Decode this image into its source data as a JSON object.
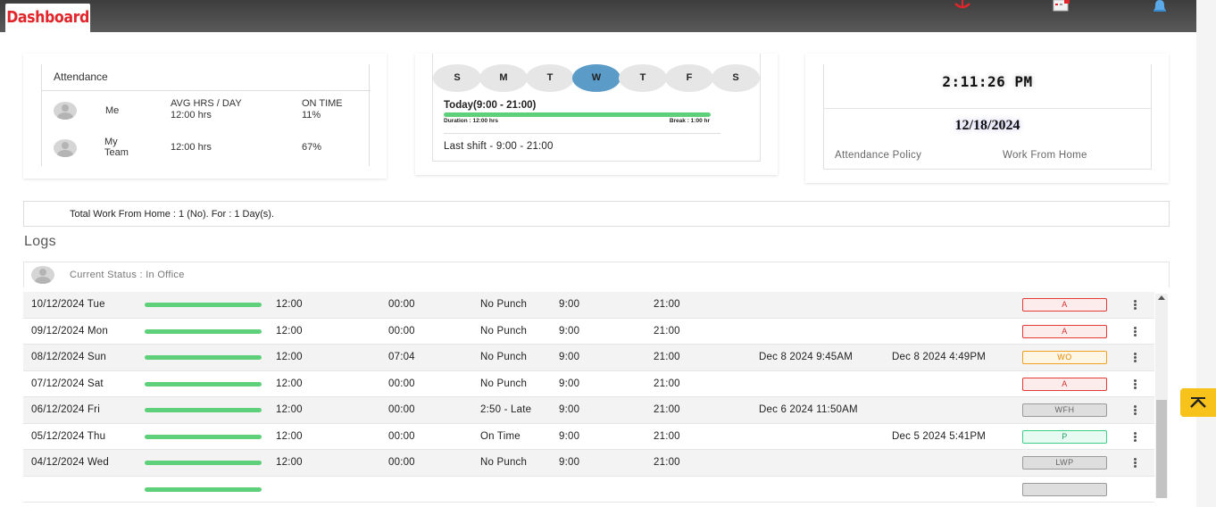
{
  "header": {
    "title": "Dashboard"
  },
  "attendance": {
    "title": "Attendance",
    "col_avg": "AVG HRS / DAY",
    "col_ontime": "ON TIME",
    "rows": [
      {
        "label": "Me",
        "hours": "12:00 hrs",
        "ontime": "11%"
      },
      {
        "label": "My Team",
        "hours": "12:00 hrs",
        "ontime": "67%"
      }
    ]
  },
  "week": {
    "days": [
      "S",
      "M",
      "T",
      "W",
      "T",
      "F",
      "S"
    ],
    "active_index": 3,
    "today_label": "Today(9:00 - 21:00)",
    "duration": "Duration : 12:00 hrs",
    "break_label": "Break : 1:00 hr",
    "last_shift": "Last shift - 9:00 - 21:00"
  },
  "clock": {
    "time": "2:11:26 PM",
    "date": "12/18/2024",
    "links": [
      "Attendance Policy",
      "Work From Home"
    ]
  },
  "wfh_summary": "Total Work From Home : 1 (No). For : 1 Day(s).",
  "logs": {
    "title": "Logs",
    "current_status": "Current Status : In Office",
    "rows": [
      {
        "date": "10/12/2024 Tue",
        "effective": "12:00",
        "gross": "00:00",
        "arrival": "No Punch",
        "shift_in": "9:00",
        "shift_out": "21:00",
        "log_in": "",
        "log_out": "",
        "status": "A",
        "status_type": "A"
      },
      {
        "date": "09/12/2024 Mon",
        "effective": "12:00",
        "gross": "00:00",
        "arrival": "No Punch",
        "shift_in": "9:00",
        "shift_out": "21:00",
        "log_in": "",
        "log_out": "",
        "status": "A",
        "status_type": "A"
      },
      {
        "date": "08/12/2024 Sun",
        "effective": "12:00",
        "gross": "07:04",
        "arrival": "No Punch",
        "shift_in": "9:00",
        "shift_out": "21:00",
        "log_in": "Dec 8 2024 9:45AM",
        "log_out": "Dec 8 2024 4:49PM",
        "status": "WO",
        "status_type": "WO"
      },
      {
        "date": "07/12/2024 Sat",
        "effective": "12:00",
        "gross": "00:00",
        "arrival": "No Punch",
        "shift_in": "9:00",
        "shift_out": "21:00",
        "log_in": "",
        "log_out": "",
        "status": "A",
        "status_type": "A"
      },
      {
        "date": "06/12/2024 Fri",
        "effective": "12:00",
        "gross": "00:00",
        "arrival": "2:50 - Late",
        "shift_in": "9:00",
        "shift_out": "21:00",
        "log_in": "Dec 6 2024 11:50AM",
        "log_out": "",
        "status": "WFH",
        "status_type": "G"
      },
      {
        "date": "05/12/2024 Thu",
        "effective": "12:00",
        "gross": "00:00",
        "arrival": "On Time",
        "shift_in": "9:00",
        "shift_out": "21:00",
        "log_in": "",
        "log_out": "Dec 5 2024 5:41PM",
        "status": "P",
        "status_type": "P"
      },
      {
        "date": "04/12/2024 Wed",
        "effective": "12:00",
        "gross": "00:00",
        "arrival": "No Punch",
        "shift_in": "9:00",
        "shift_out": "21:00",
        "log_in": "",
        "log_out": "",
        "status": "LWP",
        "status_type": "G"
      }
    ]
  },
  "colors": {
    "brand_red": "#e0262b",
    "accent_blue": "#5b9bc8",
    "progress_green": "#5fd07a",
    "scroll_top_button": "#f7c21a"
  }
}
